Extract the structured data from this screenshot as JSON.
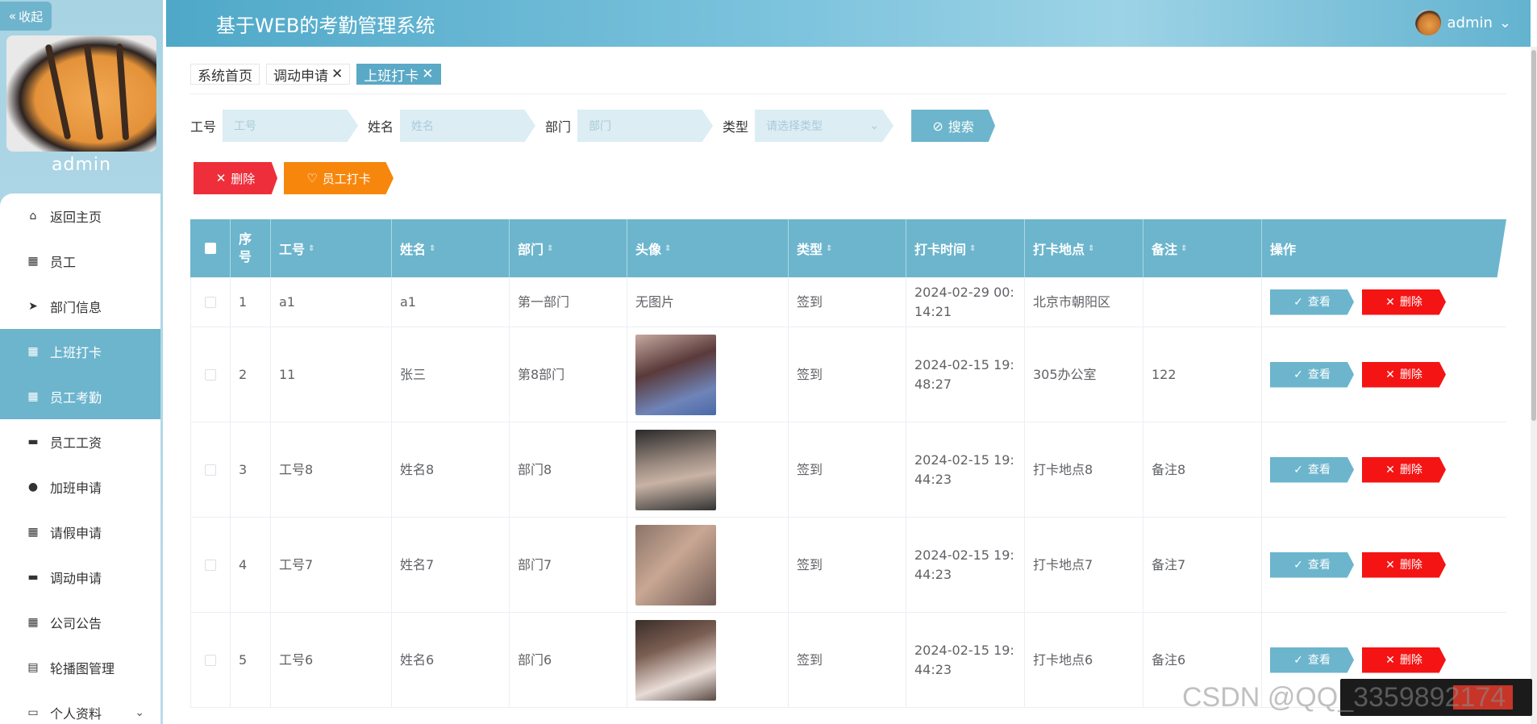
{
  "app": {
    "title": "基于WEB的考勤管理系统",
    "user": "admin"
  },
  "sidebar": {
    "collapse_label": "收起",
    "username": "admin",
    "items": [
      {
        "label": "返回主页",
        "icon": "home-icon"
      },
      {
        "label": "员工",
        "icon": "grid-icon"
      },
      {
        "label": "部门信息",
        "icon": "send-icon"
      },
      {
        "label": "上班打卡",
        "icon": "grid-icon",
        "active": true
      },
      {
        "label": "员工考勤",
        "icon": "grid-icon",
        "active": true
      },
      {
        "label": "员工工资",
        "icon": "monitor-icon"
      },
      {
        "label": "加班申请",
        "icon": "user-icon"
      },
      {
        "label": "请假申请",
        "icon": "grid-icon"
      },
      {
        "label": "调动申请",
        "icon": "monitor-icon"
      },
      {
        "label": "公司公告",
        "icon": "grid-icon"
      },
      {
        "label": "轮播图管理",
        "icon": "clipboard-icon"
      },
      {
        "label": "个人资料",
        "icon": "id-card-icon"
      }
    ]
  },
  "tabs": [
    {
      "label": "系统首页",
      "closable": false
    },
    {
      "label": "调动申请",
      "closable": true
    },
    {
      "label": "上班打卡",
      "closable": true,
      "active": true
    }
  ],
  "search": {
    "fields": [
      {
        "label": "工号",
        "placeholder": "工号"
      },
      {
        "label": "姓名",
        "placeholder": "姓名"
      },
      {
        "label": "部门",
        "placeholder": "部门"
      },
      {
        "label": "类型",
        "placeholder": "请选择类型"
      }
    ],
    "button": "搜索"
  },
  "actions": {
    "delete": "删除",
    "clock_in": "员工打卡"
  },
  "table": {
    "columns": [
      "序号",
      "工号",
      "姓名",
      "部门",
      "头像",
      "类型",
      "打卡时间",
      "打卡地点",
      "备注",
      "操作"
    ],
    "view_label": "查看",
    "delete_label": "删除",
    "rows": [
      {
        "no": "1",
        "id": "a1",
        "name": "a1",
        "dept": "第一部门",
        "photo": "无图片",
        "type": "签到",
        "time": "2024-02-29 00:14:21",
        "place": "北京市朝阳区",
        "note": ""
      },
      {
        "no": "2",
        "id": "11",
        "name": "张三",
        "dept": "第8部门",
        "photo": "",
        "type": "签到",
        "time": "2024-02-15 19:48:27",
        "place": "305办公室",
        "note": "122"
      },
      {
        "no": "3",
        "id": "工号8",
        "name": "姓名8",
        "dept": "部门8",
        "photo": "",
        "type": "签到",
        "time": "2024-02-15 19:44:23",
        "place": "打卡地点8",
        "note": "备注8"
      },
      {
        "no": "4",
        "id": "工号7",
        "name": "姓名7",
        "dept": "部门7",
        "photo": "",
        "type": "签到",
        "time": "2024-02-15 19:44:23",
        "place": "打卡地点7",
        "note": "备注7"
      },
      {
        "no": "5",
        "id": "工号6",
        "name": "姓名6",
        "dept": "部门6",
        "photo": "",
        "type": "签到",
        "time": "2024-02-15 19:44:23",
        "place": "打卡地点6",
        "note": "备注6"
      }
    ]
  },
  "watermark": "CSDN @QQ_3359892174"
}
